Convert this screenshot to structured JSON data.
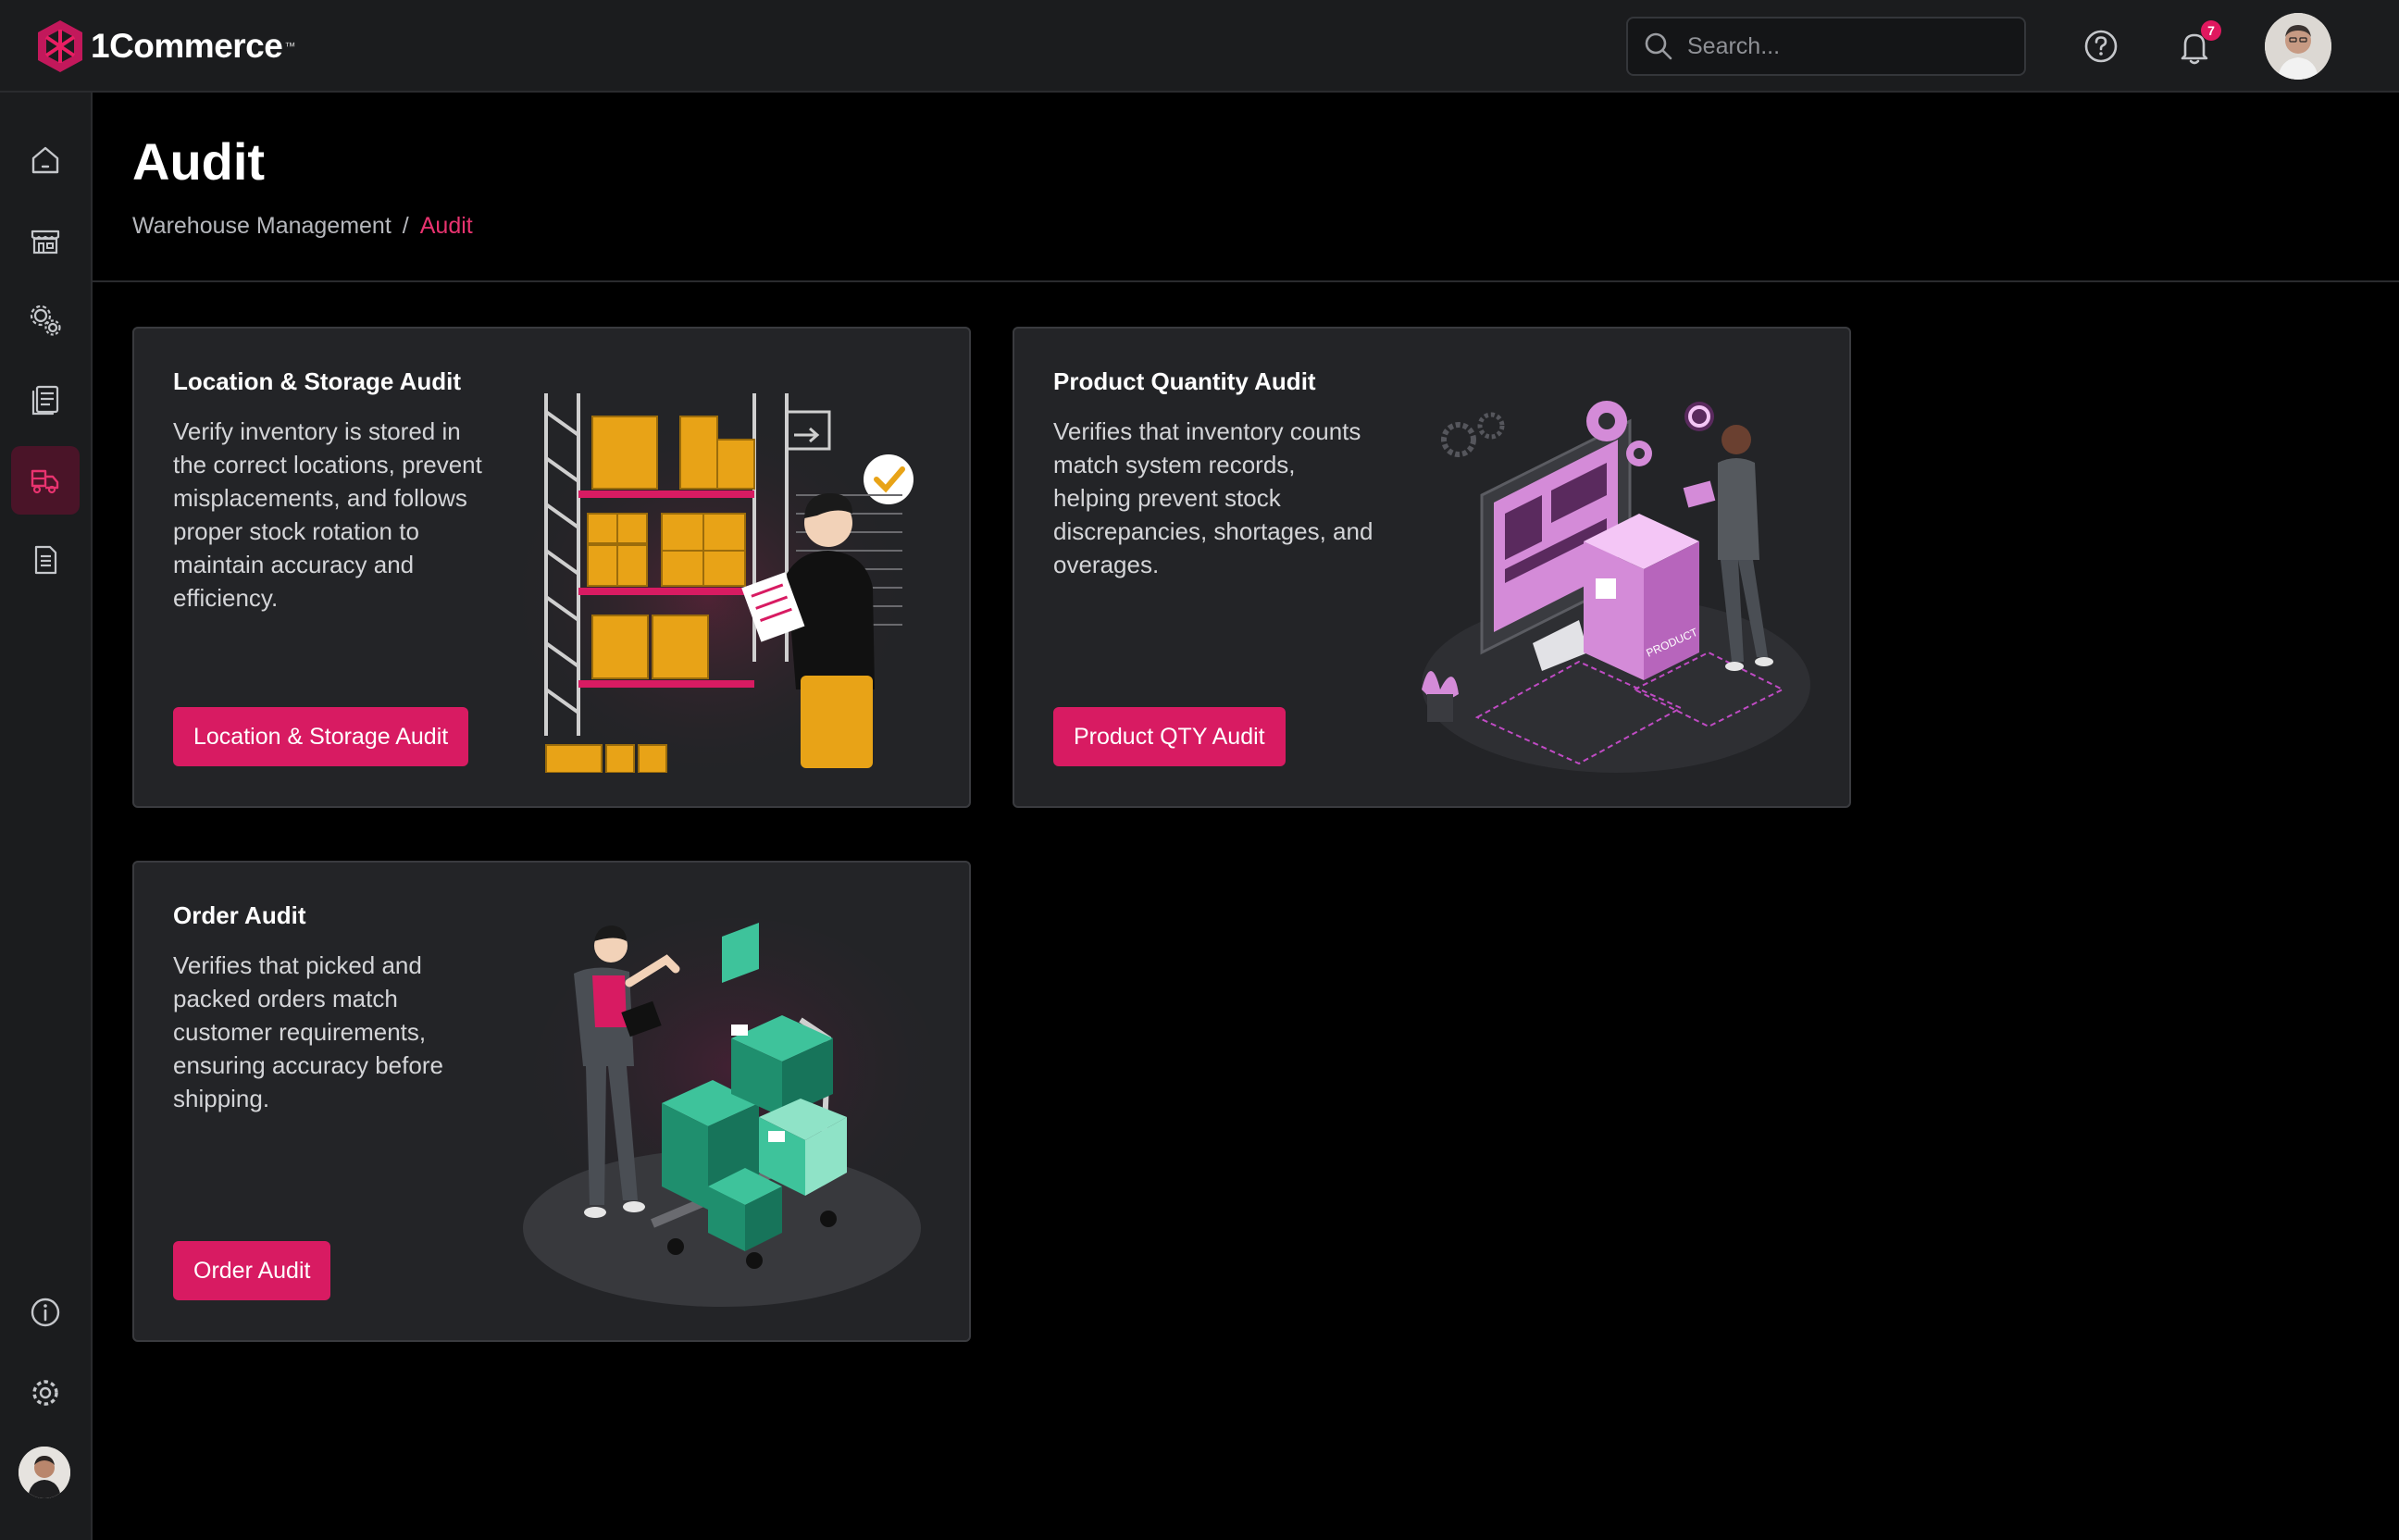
{
  "app": {
    "name": "1Commerce",
    "trademark": "™"
  },
  "header": {
    "search_placeholder": "Search...",
    "notification_count": "7"
  },
  "sidebar": {
    "items": [
      {
        "icon": "home-icon"
      },
      {
        "icon": "store-icon"
      },
      {
        "icon": "gears-icon"
      },
      {
        "icon": "catalog-icon"
      },
      {
        "icon": "warehouse-truck-icon",
        "active": true
      },
      {
        "icon": "document-icon"
      }
    ],
    "bottom": [
      {
        "icon": "info-icon"
      },
      {
        "icon": "settings-icon"
      }
    ]
  },
  "page": {
    "title": "Audit",
    "breadcrumb": {
      "parent": "Warehouse Management",
      "separator": "/",
      "current": "Audit"
    }
  },
  "cards": [
    {
      "title": "Location & Storage Audit",
      "description": "Verify inventory is stored in the correct locations, prevent misplacements, and follows proper stock rotation to maintain accuracy and efficiency.",
      "button": "Location & Storage Audit",
      "illustration": "warehouse-shelves-illustration"
    },
    {
      "title": "Product Quantity Audit",
      "description": "Verifies that inventory counts match system records, helping prevent stock discrepancies, shortages, and overages.",
      "button": "Product QTY Audit",
      "illustration": "product-quantity-illustration",
      "illustration_text": "PRODUCT"
    },
    {
      "title": "Order Audit",
      "description": "Verifies that picked and packed orders match customer requirements, ensuring accuracy before shipping.",
      "button": "Order Audit",
      "illustration": "order-boxes-illustration"
    }
  ],
  "colors": {
    "accent": "#d81b62",
    "accent_text": "#e8336f",
    "panel": "#1b1c1e",
    "card": "#232427",
    "background": "#000000"
  }
}
